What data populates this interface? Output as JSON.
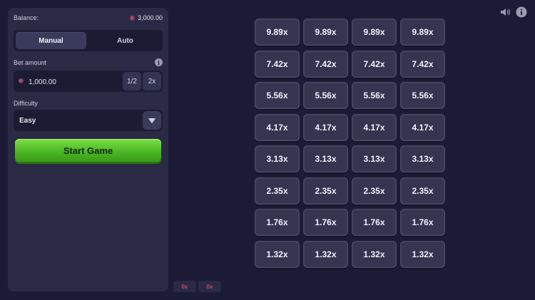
{
  "balance": {
    "label": "Balance:",
    "value": "3,000.00"
  },
  "mode_tabs": [
    {
      "label": "Manual",
      "active": true
    },
    {
      "label": "Auto",
      "active": false
    }
  ],
  "bet": {
    "label": "Bet amount",
    "value": "1,000.00",
    "half_label": "1/2",
    "double_label": "2x"
  },
  "difficulty": {
    "label": "Difficulty",
    "selected": "Easy"
  },
  "start_button": {
    "label": "Start Game",
    "color": "#4cb824"
  },
  "multipliers": [
    [
      "9.89x",
      "9.89x",
      "9.89x",
      "9.89x"
    ],
    [
      "7.42x",
      "7.42x",
      "7.42x",
      "7.42x"
    ],
    [
      "5.56x",
      "5.56x",
      "5.56x",
      "5.56x"
    ],
    [
      "4.17x",
      "4.17x",
      "4.17x",
      "4.17x"
    ],
    [
      "3.13x",
      "3.13x",
      "3.13x",
      "3.13x"
    ],
    [
      "2.35x",
      "2.35x",
      "2.35x",
      "2.35x"
    ],
    [
      "1.76x",
      "1.76x",
      "1.76x",
      "1.76x"
    ],
    [
      "1.32x",
      "1.32x",
      "1.32x",
      "1.32x"
    ]
  ],
  "stats": [
    "0x",
    "0x"
  ],
  "icons": {
    "sound": "speaker-icon",
    "info": "info-icon",
    "currency": "coin-icon"
  }
}
